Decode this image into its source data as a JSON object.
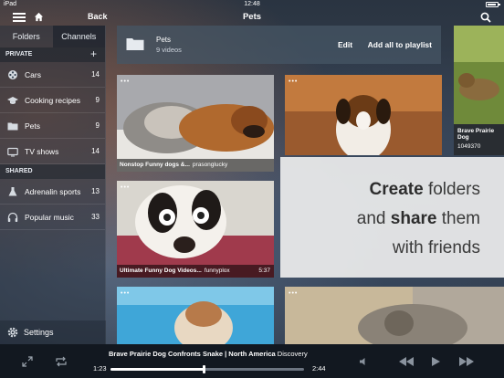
{
  "status_bar": {
    "carrier": "iPad",
    "time": "12:48",
    "battery_level": 0.85
  },
  "top_nav": {
    "back_label": "Back",
    "title": "Pets"
  },
  "sidebar": {
    "tabs": [
      {
        "label": "Folders"
      },
      {
        "label": "Channels"
      }
    ],
    "private_section": "PRIVATE",
    "private_items": [
      {
        "label": "Cars",
        "count": "14",
        "icon": "film-reel-icon"
      },
      {
        "label": "Cooking recipes",
        "count": "9",
        "icon": "graduation-cap-icon"
      },
      {
        "label": "Pets",
        "count": "9",
        "icon": "folder-icon"
      },
      {
        "label": "TV shows",
        "count": "14",
        "icon": "tv-icon"
      }
    ],
    "shared_section": "SHARED",
    "shared_items": [
      {
        "label": "Adrenalin sports",
        "count": "13",
        "icon": "flask-icon"
      },
      {
        "label": "Popular music",
        "count": "33",
        "icon": "headphones-icon"
      }
    ],
    "settings_label": "Settings"
  },
  "folder_header": {
    "name": "Pets",
    "subtitle": "9 videos",
    "edit_label": "Edit",
    "add_all_label": "Add all to playlist"
  },
  "videos": [
    {
      "title": "Nonstop Funny dogs &...",
      "channel": "prasonglucky",
      "duration": ""
    },
    {
      "title": "",
      "channel": "",
      "duration": ""
    },
    {
      "title": "Ultimate Funny Dog Videos...",
      "channel": "funnyplox",
      "duration": "5:37"
    },
    {
      "title": "Brave Prairie Dog",
      "channel": "",
      "views": "1049370"
    }
  ],
  "promo": {
    "line1_bold": "Create",
    "line1_rest": " folders",
    "line2_pre": "and ",
    "line2_bold": "share",
    "line2_rest": " them",
    "line3": "with friends"
  },
  "player": {
    "track_title": "Brave Prairie Dog Confronts Snake | North America",
    "track_channel": "Discovery",
    "elapsed": "1:23",
    "remaining": "2:44",
    "progress": 0.48
  }
}
